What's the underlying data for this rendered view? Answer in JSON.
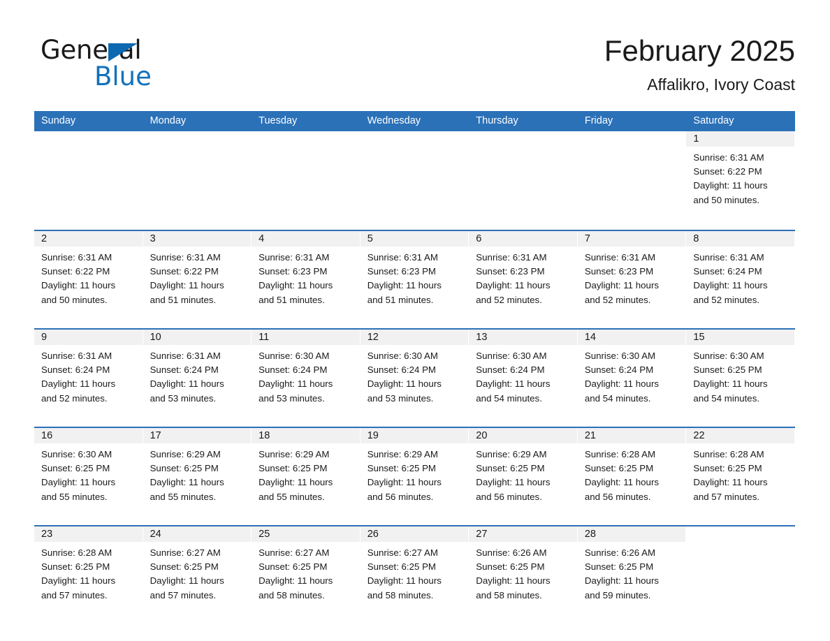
{
  "brand": {
    "word_one": "General",
    "word_two": "Blue",
    "flag_icon": "triangle-flag-icon",
    "accent_color": "#1371bb"
  },
  "header": {
    "title": "February 2025",
    "subtitle": "Affalikro, Ivory Coast"
  },
  "colors": {
    "header_blue": "#2b71b8",
    "daynum_band": "#f1f1f1",
    "text": "#1a1a1a"
  },
  "weekdays": [
    "Sunday",
    "Monday",
    "Tuesday",
    "Wednesday",
    "Thursday",
    "Friday",
    "Saturday"
  ],
  "weeks": [
    [
      {
        "day": "",
        "lines": []
      },
      {
        "day": "",
        "lines": []
      },
      {
        "day": "",
        "lines": []
      },
      {
        "day": "",
        "lines": []
      },
      {
        "day": "",
        "lines": []
      },
      {
        "day": "",
        "lines": []
      },
      {
        "day": "1",
        "lines": [
          "Sunrise: 6:31 AM",
          "Sunset: 6:22 PM",
          "Daylight: 11 hours",
          "and 50 minutes."
        ]
      }
    ],
    [
      {
        "day": "2",
        "lines": [
          "Sunrise: 6:31 AM",
          "Sunset: 6:22 PM",
          "Daylight: 11 hours",
          "and 50 minutes."
        ]
      },
      {
        "day": "3",
        "lines": [
          "Sunrise: 6:31 AM",
          "Sunset: 6:22 PM",
          "Daylight: 11 hours",
          "and 51 minutes."
        ]
      },
      {
        "day": "4",
        "lines": [
          "Sunrise: 6:31 AM",
          "Sunset: 6:23 PM",
          "Daylight: 11 hours",
          "and 51 minutes."
        ]
      },
      {
        "day": "5",
        "lines": [
          "Sunrise: 6:31 AM",
          "Sunset: 6:23 PM",
          "Daylight: 11 hours",
          "and 51 minutes."
        ]
      },
      {
        "day": "6",
        "lines": [
          "Sunrise: 6:31 AM",
          "Sunset: 6:23 PM",
          "Daylight: 11 hours",
          "and 52 minutes."
        ]
      },
      {
        "day": "7",
        "lines": [
          "Sunrise: 6:31 AM",
          "Sunset: 6:23 PM",
          "Daylight: 11 hours",
          "and 52 minutes."
        ]
      },
      {
        "day": "8",
        "lines": [
          "Sunrise: 6:31 AM",
          "Sunset: 6:24 PM",
          "Daylight: 11 hours",
          "and 52 minutes."
        ]
      }
    ],
    [
      {
        "day": "9",
        "lines": [
          "Sunrise: 6:31 AM",
          "Sunset: 6:24 PM",
          "Daylight: 11 hours",
          "and 52 minutes."
        ]
      },
      {
        "day": "10",
        "lines": [
          "Sunrise: 6:31 AM",
          "Sunset: 6:24 PM",
          "Daylight: 11 hours",
          "and 53 minutes."
        ]
      },
      {
        "day": "11",
        "lines": [
          "Sunrise: 6:30 AM",
          "Sunset: 6:24 PM",
          "Daylight: 11 hours",
          "and 53 minutes."
        ]
      },
      {
        "day": "12",
        "lines": [
          "Sunrise: 6:30 AM",
          "Sunset: 6:24 PM",
          "Daylight: 11 hours",
          "and 53 minutes."
        ]
      },
      {
        "day": "13",
        "lines": [
          "Sunrise: 6:30 AM",
          "Sunset: 6:24 PM",
          "Daylight: 11 hours",
          "and 54 minutes."
        ]
      },
      {
        "day": "14",
        "lines": [
          "Sunrise: 6:30 AM",
          "Sunset: 6:24 PM",
          "Daylight: 11 hours",
          "and 54 minutes."
        ]
      },
      {
        "day": "15",
        "lines": [
          "Sunrise: 6:30 AM",
          "Sunset: 6:25 PM",
          "Daylight: 11 hours",
          "and 54 minutes."
        ]
      }
    ],
    [
      {
        "day": "16",
        "lines": [
          "Sunrise: 6:30 AM",
          "Sunset: 6:25 PM",
          "Daylight: 11 hours",
          "and 55 minutes."
        ]
      },
      {
        "day": "17",
        "lines": [
          "Sunrise: 6:29 AM",
          "Sunset: 6:25 PM",
          "Daylight: 11 hours",
          "and 55 minutes."
        ]
      },
      {
        "day": "18",
        "lines": [
          "Sunrise: 6:29 AM",
          "Sunset: 6:25 PM",
          "Daylight: 11 hours",
          "and 55 minutes."
        ]
      },
      {
        "day": "19",
        "lines": [
          "Sunrise: 6:29 AM",
          "Sunset: 6:25 PM",
          "Daylight: 11 hours",
          "and 56 minutes."
        ]
      },
      {
        "day": "20",
        "lines": [
          "Sunrise: 6:29 AM",
          "Sunset: 6:25 PM",
          "Daylight: 11 hours",
          "and 56 minutes."
        ]
      },
      {
        "day": "21",
        "lines": [
          "Sunrise: 6:28 AM",
          "Sunset: 6:25 PM",
          "Daylight: 11 hours",
          "and 56 minutes."
        ]
      },
      {
        "day": "22",
        "lines": [
          "Sunrise: 6:28 AM",
          "Sunset: 6:25 PM",
          "Daylight: 11 hours",
          "and 57 minutes."
        ]
      }
    ],
    [
      {
        "day": "23",
        "lines": [
          "Sunrise: 6:28 AM",
          "Sunset: 6:25 PM",
          "Daylight: 11 hours",
          "and 57 minutes."
        ]
      },
      {
        "day": "24",
        "lines": [
          "Sunrise: 6:27 AM",
          "Sunset: 6:25 PM",
          "Daylight: 11 hours",
          "and 57 minutes."
        ]
      },
      {
        "day": "25",
        "lines": [
          "Sunrise: 6:27 AM",
          "Sunset: 6:25 PM",
          "Daylight: 11 hours",
          "and 58 minutes."
        ]
      },
      {
        "day": "26",
        "lines": [
          "Sunrise: 6:27 AM",
          "Sunset: 6:25 PM",
          "Daylight: 11 hours",
          "and 58 minutes."
        ]
      },
      {
        "day": "27",
        "lines": [
          "Sunrise: 6:26 AM",
          "Sunset: 6:25 PM",
          "Daylight: 11 hours",
          "and 58 minutes."
        ]
      },
      {
        "day": "28",
        "lines": [
          "Sunrise: 6:26 AM",
          "Sunset: 6:25 PM",
          "Daylight: 11 hours",
          "and 59 minutes."
        ]
      },
      {
        "day": "",
        "lines": []
      }
    ]
  ]
}
